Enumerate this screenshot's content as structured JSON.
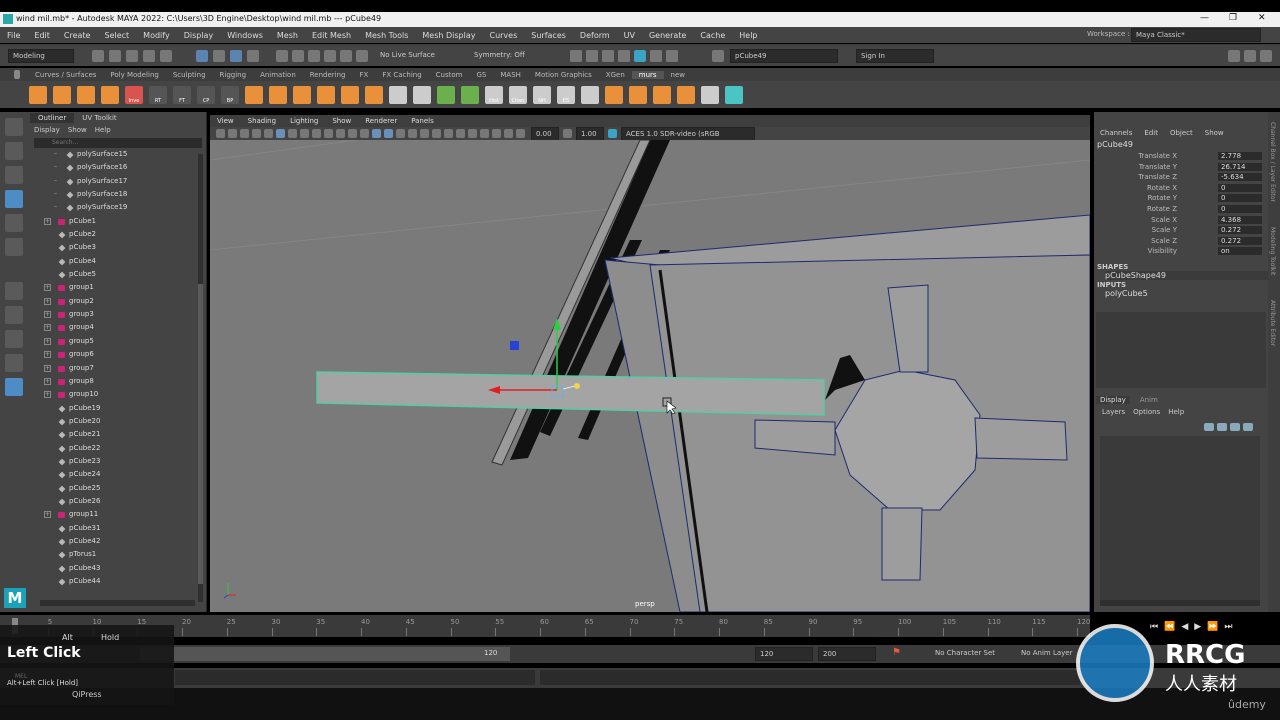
{
  "window": {
    "title": "wind mil.mb* - Autodesk MAYA 2022: C:\\Users\\3D Engine\\Desktop\\wind mil.mb   ---   pCube49",
    "min": "—",
    "max": "❐",
    "close": "✕"
  },
  "menubar": [
    "File",
    "Edit",
    "Create",
    "Select",
    "Modify",
    "Display",
    "Windows",
    "Mesh",
    "Edit Mesh",
    "Mesh Tools",
    "Mesh Display",
    "Curves",
    "Surfaces",
    "Deform",
    "UV",
    "Generate",
    "Cache",
    "Help"
  ],
  "workspace": {
    "label": "Workspace :",
    "value": "Maya Classic*"
  },
  "statusline": {
    "mode": "Modeling",
    "live_surface": "No Live Surface",
    "symmetry": "Symmetry: Off",
    "object_field": "pCube49",
    "sign_in": "Sign In"
  },
  "shelf_tabs": [
    "Curves / Surfaces",
    "Poly Modeling",
    "Sculpting",
    "Rigging",
    "Animation",
    "Rendering",
    "FX",
    "FX Caching",
    "Custom",
    "GS",
    "MASH",
    "Motion Graphics",
    "XGen",
    "murs",
    "new"
  ],
  "shelf_active": "murs",
  "shelf_icons": [
    {
      "name": "sphere-icon",
      "color": "#e8913a",
      "label": ""
    },
    {
      "name": "cube-icon",
      "color": "#e8913a",
      "label": ""
    },
    {
      "name": "cylinder-icon",
      "color": "#e8913a",
      "label": ""
    },
    {
      "name": "pyramid-icon",
      "color": "#e8913a",
      "label": ""
    },
    {
      "name": "inverse-icon",
      "color": "#d9534f",
      "label": "Inve"
    },
    {
      "name": "rt-icon",
      "color": "#555",
      "label": "RT"
    },
    {
      "name": "ft-icon",
      "color": "#555",
      "label": "FT"
    },
    {
      "name": "cp-icon",
      "color": "#555",
      "label": "CP"
    },
    {
      "name": "bp-icon",
      "color": "#555",
      "label": "BP"
    },
    {
      "name": "torus-icon",
      "color": "#e8913a",
      "label": ""
    },
    {
      "name": "extrude-icon",
      "color": "#e8913a",
      "label": ""
    },
    {
      "name": "bevel-icon",
      "color": "#e8913a",
      "label": ""
    },
    {
      "name": "bridge-icon",
      "color": "#e8913a",
      "label": ""
    },
    {
      "name": "combine-icon",
      "color": "#e8913a",
      "label": ""
    },
    {
      "name": "separate-icon",
      "color": "#e8913a",
      "label": ""
    },
    {
      "name": "mirror-icon",
      "color": "#cccccc",
      "label": ""
    },
    {
      "name": "grid-icon",
      "color": "#cccccc",
      "label": ""
    },
    {
      "name": "smooth-icon",
      "color": "#6ab04c",
      "label": ""
    },
    {
      "name": "booleans-icon",
      "color": "#6ab04c",
      "label": ""
    },
    {
      "name": "hist-icon",
      "color": "#cccccc",
      "label": "Hist"
    },
    {
      "name": "chan-icon",
      "color": "#cccccc",
      "label": "Chan"
    },
    {
      "name": "nh-icon",
      "color": "#cccccc",
      "label": "NH"
    },
    {
      "name": "es-icon",
      "color": "#cccccc",
      "label": "ES"
    },
    {
      "name": "multicut-icon",
      "color": "#cccccc",
      "label": ""
    },
    {
      "name": "box-icon",
      "color": "#e8913a",
      "label": ""
    },
    {
      "name": "target-weld-icon",
      "color": "#e8913a",
      "label": ""
    },
    {
      "name": "quad-draw-icon",
      "color": "#e8913a",
      "label": ""
    },
    {
      "name": "sphere2-icon",
      "color": "#e8913a",
      "label": ""
    },
    {
      "name": "align-icon",
      "color": "#cccccc",
      "label": ""
    },
    {
      "name": "distribute-icon",
      "color": "#4dc4c4",
      "label": ""
    }
  ],
  "outliner": {
    "tabs": [
      "Outliner",
      "UV Toolkit"
    ],
    "menu": [
      "Display",
      "Show",
      "Help"
    ],
    "search_placeholder": "Search...",
    "items": [
      {
        "name": "polySurface15",
        "type": "shape",
        "indent": 2
      },
      {
        "name": "polySurface16",
        "type": "shape",
        "indent": 2
      },
      {
        "name": "polySurface17",
        "type": "shape",
        "indent": 2
      },
      {
        "name": "polySurface18",
        "type": "shape",
        "indent": 2
      },
      {
        "name": "polySurface19",
        "type": "shape",
        "indent": 2
      },
      {
        "name": "pCube1",
        "type": "group",
        "indent": 1
      },
      {
        "name": "pCube2",
        "type": "shape",
        "indent": 1
      },
      {
        "name": "pCube3",
        "type": "shape",
        "indent": 1
      },
      {
        "name": "pCube4",
        "type": "shape",
        "indent": 1
      },
      {
        "name": "pCube5",
        "type": "shape",
        "indent": 1
      },
      {
        "name": "group1",
        "type": "group",
        "indent": 1
      },
      {
        "name": "group2",
        "type": "group",
        "indent": 1
      },
      {
        "name": "group3",
        "type": "group",
        "indent": 1
      },
      {
        "name": "group4",
        "type": "group",
        "indent": 1
      },
      {
        "name": "group5",
        "type": "group",
        "indent": 1
      },
      {
        "name": "group6",
        "type": "group",
        "indent": 1
      },
      {
        "name": "group7",
        "type": "group",
        "indent": 1
      },
      {
        "name": "group8",
        "type": "group",
        "indent": 1
      },
      {
        "name": "group10",
        "type": "group",
        "indent": 1
      },
      {
        "name": "pCube19",
        "type": "shape",
        "indent": 1
      },
      {
        "name": "pCube20",
        "type": "shape",
        "indent": 1
      },
      {
        "name": "pCube21",
        "type": "shape",
        "indent": 1
      },
      {
        "name": "pCube22",
        "type": "shape",
        "indent": 1
      },
      {
        "name": "pCube23",
        "type": "shape",
        "indent": 1
      },
      {
        "name": "pCube24",
        "type": "shape",
        "indent": 1
      },
      {
        "name": "pCube25",
        "type": "shape",
        "indent": 1
      },
      {
        "name": "pCube26",
        "type": "shape",
        "indent": 1
      },
      {
        "name": "group11",
        "type": "group",
        "indent": 1
      },
      {
        "name": "pCube31",
        "type": "shape",
        "indent": 1
      },
      {
        "name": "pCube42",
        "type": "shape",
        "indent": 1
      },
      {
        "name": "pTorus1",
        "type": "shape",
        "indent": 1
      },
      {
        "name": "pCube43",
        "type": "shape",
        "indent": 1
      },
      {
        "name": "pCube44",
        "type": "shape",
        "indent": 1
      }
    ]
  },
  "viewport": {
    "menu": [
      "View",
      "Shading",
      "Lighting",
      "Show",
      "Renderer",
      "Panels"
    ],
    "exposure": "0.00",
    "gamma": "1.00",
    "color_space": "ACES 1.0 SDR-video (sRGB",
    "camera": "persp"
  },
  "channelbox": {
    "menu": [
      "Channels",
      "Edit",
      "Object",
      "Show"
    ],
    "object": "pCube49",
    "attrs": [
      {
        "k": "Translate X",
        "v": "2.778"
      },
      {
        "k": "Translate Y",
        "v": "26.714"
      },
      {
        "k": "Translate Z",
        "v": "-5.634"
      },
      {
        "k": "Rotate X",
        "v": "0"
      },
      {
        "k": "Rotate Y",
        "v": "0"
      },
      {
        "k": "Rotate Z",
        "v": "0"
      },
      {
        "k": "Scale X",
        "v": "4.368"
      },
      {
        "k": "Scale Y",
        "v": "0.272"
      },
      {
        "k": "Scale Z",
        "v": "0.272"
      },
      {
        "k": "Visibility",
        "v": "on"
      }
    ],
    "shapes_header": "SHAPES",
    "shape": "pCubeShape49",
    "inputs_header": "INPUTS",
    "input": "polyCube5",
    "layer_tabs": [
      "Display",
      "Anim"
    ],
    "layer_menu": [
      "Layers",
      "Options",
      "Help"
    ]
  },
  "side_tabs": [
    "Channel Box / Layer Editor",
    "Modeling Toolkit",
    "Attribute Editor"
  ],
  "timeline": {
    "ticks": [
      "1",
      "5",
      "10",
      "15",
      "20",
      "25",
      "30",
      "35",
      "40",
      "45",
      "50",
      "55",
      "60",
      "65",
      "70",
      "75",
      "80",
      "85",
      "90",
      "95",
      "100",
      "105",
      "110",
      "115",
      "120"
    ],
    "current": "1"
  },
  "range": {
    "start": "1",
    "range_start": "1",
    "range_end": "120",
    "end_a": "120",
    "end_b": "200",
    "char_set": "No Character Set",
    "anim_layer": "No Anim Layer"
  },
  "key_overlay": {
    "alt": "Alt",
    "hold": "Hold",
    "action": "Left Click",
    "desc": "Alt+Left Click [Hold]",
    "app": "QiPress",
    "mel": "MEL"
  },
  "watermark": {
    "brand": "RRCG",
    "sub": "人人素材",
    "udemy": "ûdemy"
  }
}
